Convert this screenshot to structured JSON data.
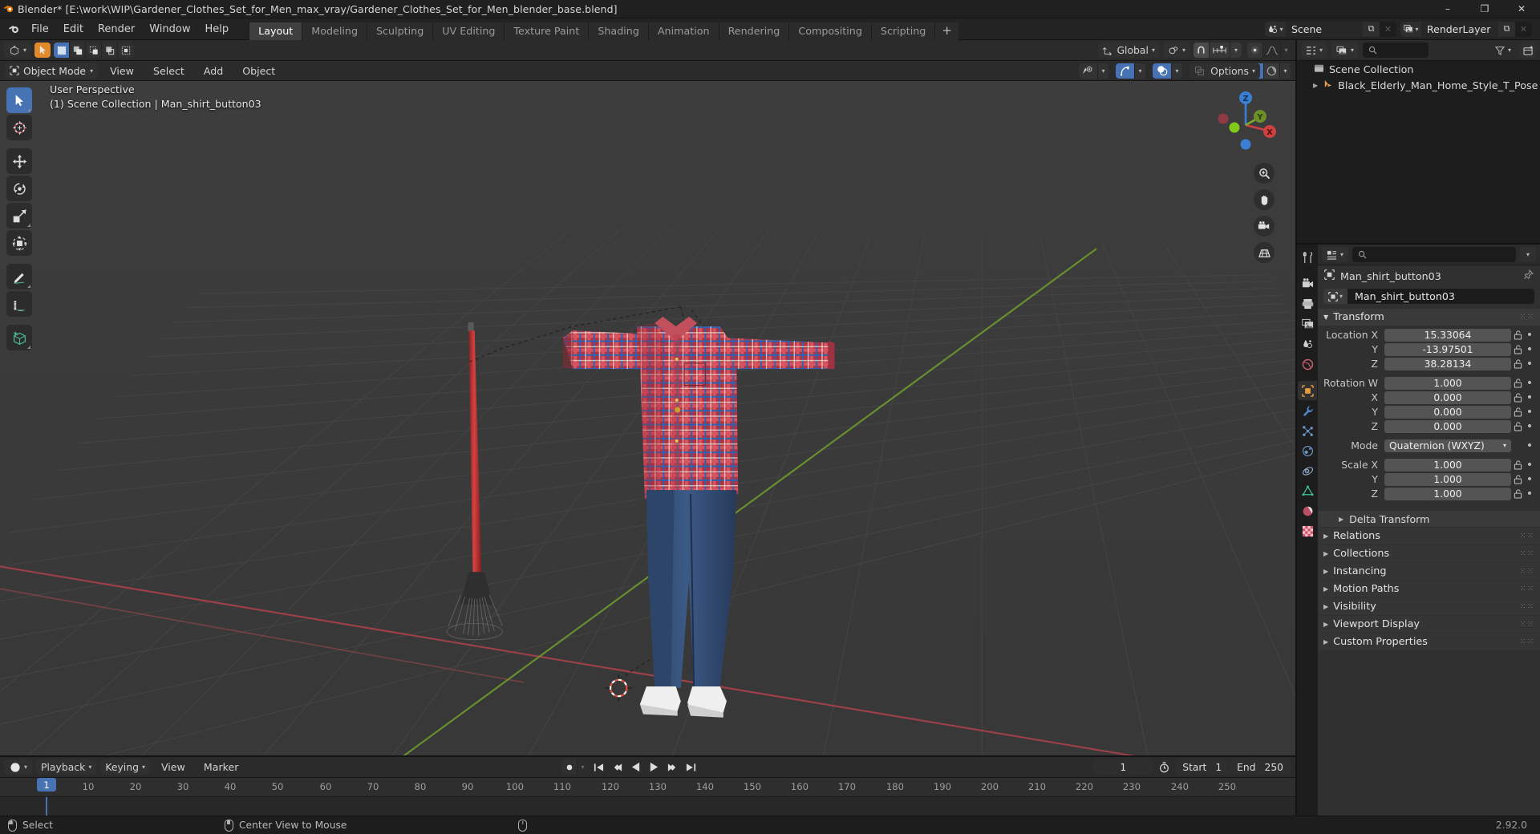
{
  "titlebar": {
    "title": "Blender* [E:\\work\\WIP\\Gardener_Clothes_Set_for_Men_max_vray/Gardener_Clothes_Set_for_Men_blender_base.blend]",
    "minimize": "–",
    "maximize": "❐",
    "close": "✕"
  },
  "topbar": {
    "menus": [
      "File",
      "Edit",
      "Render",
      "Window",
      "Help"
    ],
    "workspaces": [
      {
        "label": "Layout",
        "active": true
      },
      {
        "label": "Modeling",
        "active": false
      },
      {
        "label": "Sculpting",
        "active": false
      },
      {
        "label": "UV Editing",
        "active": false
      },
      {
        "label": "Texture Paint",
        "active": false
      },
      {
        "label": "Shading",
        "active": false
      },
      {
        "label": "Animation",
        "active": false
      },
      {
        "label": "Rendering",
        "active": false
      },
      {
        "label": "Compositing",
        "active": false
      },
      {
        "label": "Scripting",
        "active": false
      }
    ],
    "add_workspace": "+",
    "scene_name": "Scene",
    "viewlayer_name": "RenderLayer",
    "new_copy_label": "⧉",
    "unlink_label": "✕"
  },
  "viewport": {
    "header": {
      "editor_type": "editor-type-3dview",
      "mode": "Object Mode",
      "menus": [
        "View",
        "Select",
        "Add",
        "Object"
      ],
      "transform_orientation": "Global",
      "options_label": "Options"
    },
    "overlay_line1": "User Perspective",
    "overlay_line2": "(1) Scene Collection | Man_shirt_button03",
    "gizmo_axes": {
      "x": "X",
      "y": "Y",
      "z": "Z"
    },
    "tools": [
      {
        "name": "tweak-select-tool",
        "active": true
      },
      {
        "name": "cursor-tool",
        "active": false
      },
      {
        "name": "move-tool",
        "active": false
      },
      {
        "name": "rotate-tool",
        "active": false
      },
      {
        "name": "scale-tool",
        "active": false
      },
      {
        "name": "transform-tool",
        "active": false
      },
      {
        "name": "annotate-tool",
        "active": false
      },
      {
        "name": "measure-tool",
        "active": false
      },
      {
        "name": "add-cube-tool",
        "active": false
      }
    ],
    "nav_buttons": [
      "zoom-icon",
      "pan-hand-icon",
      "camera-icon",
      "orthographic-grid-icon"
    ]
  },
  "timeline": {
    "editor_type": "editor-type-timeline",
    "menus": [
      "Playback",
      "Keying",
      "View",
      "Marker"
    ],
    "current_frame": "1",
    "start_label": "Start",
    "start_value": "1",
    "end_label": "End",
    "end_value": "250",
    "ticks": [
      "10",
      "20",
      "30",
      "40",
      "50",
      "60",
      "70",
      "80",
      "90",
      "100",
      "110",
      "120",
      "130",
      "140",
      "150",
      "160",
      "170",
      "180",
      "190",
      "200",
      "210",
      "220",
      "230",
      "240",
      "250"
    ],
    "playhead_label": "1"
  },
  "statusbar": {
    "select_label": "Select",
    "center_view_label": "Center View to Mouse",
    "version": "2.92.0"
  },
  "outliner": {
    "rows": [
      {
        "label": "Scene Collection",
        "icon": "collection-icon",
        "indent": false,
        "has_tri": false
      },
      {
        "label": "Black_Elderly_Man_Home_Style_T_Pose",
        "icon": "armature-icon",
        "indent": true,
        "has_tri": true
      }
    ],
    "filter_icon": "filter-icon",
    "new_collection_icon": "new-collection-icon"
  },
  "properties": {
    "tabs": [
      {
        "name": "tool-tab",
        "active": false
      },
      {
        "name": "render-tab",
        "active": false
      },
      {
        "name": "output-tab",
        "active": false
      },
      {
        "name": "view-layer-tab",
        "active": false
      },
      {
        "name": "scene-tab",
        "active": false
      },
      {
        "name": "world-tab",
        "active": false
      },
      {
        "name": "object-tab",
        "active": true
      },
      {
        "name": "modifier-tab",
        "active": false
      },
      {
        "name": "particles-tab",
        "active": false
      },
      {
        "name": "physics-tab",
        "active": false
      },
      {
        "name": "constraints-tab",
        "active": false
      },
      {
        "name": "object-data-tab",
        "active": false
      },
      {
        "name": "material-tab",
        "active": false
      },
      {
        "name": "texture-tab",
        "active": false
      }
    ],
    "breadcrumb": "Man_shirt_button03",
    "object_name": "Man_shirt_button03",
    "transform": {
      "title": "Transform",
      "rows": [
        {
          "label": "Location X",
          "value": "15.33064",
          "lock": true
        },
        {
          "label": "Y",
          "value": "-13.97501",
          "lock": true
        },
        {
          "label": "Z",
          "value": "38.28134",
          "lock": true
        }
      ],
      "rotation_rows": [
        {
          "label": "Rotation W",
          "value": "1.000",
          "lock": true
        },
        {
          "label": "X",
          "value": "0.000",
          "lock": true
        },
        {
          "label": "Y",
          "value": "0.000",
          "lock": true
        },
        {
          "label": "Z",
          "value": "0.000",
          "lock": true
        }
      ],
      "mode_label": "Mode",
      "mode_value": "Quaternion (WXYZ)",
      "scale_rows": [
        {
          "label": "Scale X",
          "value": "1.000",
          "lock": true
        },
        {
          "label": "Y",
          "value": "1.000",
          "lock": true
        },
        {
          "label": "Z",
          "value": "1.000",
          "lock": true
        }
      ],
      "delta_label": "Delta Transform"
    },
    "panels": [
      {
        "label": "Relations"
      },
      {
        "label": "Collections"
      },
      {
        "label": "Instancing"
      },
      {
        "label": "Motion Paths"
      },
      {
        "label": "Visibility"
      },
      {
        "label": "Viewport Display"
      },
      {
        "label": "Custom Properties"
      }
    ]
  },
  "colors": {
    "accent_blue": "#4772b3",
    "accent_orange": "#e08a2b",
    "axis_x_red": "#cf4040",
    "axis_y_green": "#7fad2a",
    "axis_z_blue": "#3b7fd4",
    "bg_dark": "#1d1d1d",
    "bg_panel": "#303030",
    "viewport_bg": "#393939"
  }
}
